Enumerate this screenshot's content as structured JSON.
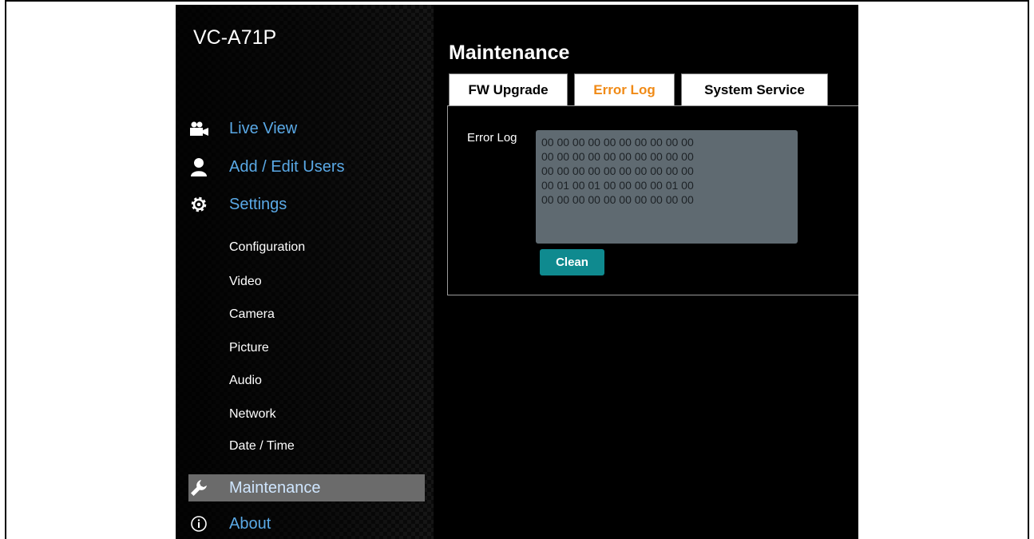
{
  "app": {
    "model_name": "VC-A71P"
  },
  "nav": {
    "live_view": "Live View",
    "add_edit_users": "Add / Edit Users",
    "settings": "Settings",
    "maintenance": "Maintenance",
    "about": "About"
  },
  "settings_submenu": [
    "Configuration",
    "Video",
    "Camera",
    "Picture",
    "Audio",
    "Network",
    "Date / Time"
  ],
  "main": {
    "title": "Maintenance",
    "tabs": [
      {
        "label": "FW Upgrade",
        "active": false
      },
      {
        "label": "Error Log",
        "active": true
      },
      {
        "label": "System Service",
        "active": false
      }
    ],
    "error_log": {
      "label": "Error Log",
      "value": "00 00 00 00 00 00 00 00 00 00\n00 00 00 00 00 00 00 00 00 00\n00 00 00 00 00 00 00 00 00 00\n00 01 00 01 00 00 00 00 01 00\n00 00 00 00 00 00 00 00 00 00"
    },
    "clean_button": "Clean"
  },
  "colors": {
    "accent_tab": "#f08a16",
    "nav_link": "#5aa9e6",
    "button": "#0f8a8f",
    "log_box": "#5f6a71"
  }
}
